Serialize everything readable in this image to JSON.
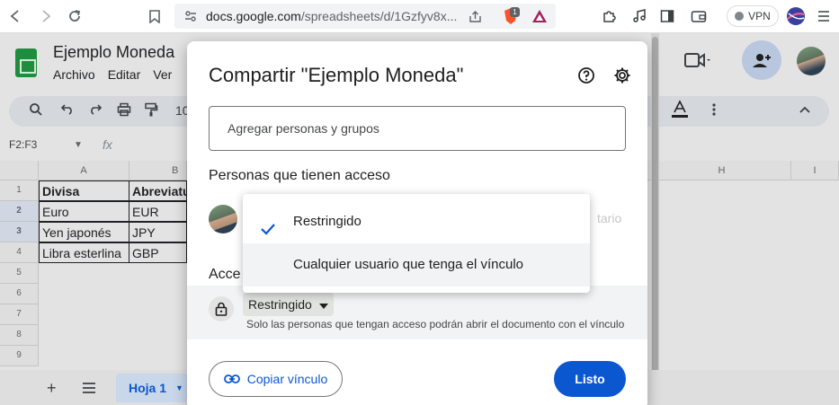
{
  "browser": {
    "url_host": "docs.google.com",
    "url_path": "/spreadsheets/d/1Gzfyv8x...",
    "vpn_label": "VPN",
    "brave_badge": "1"
  },
  "sheets": {
    "doc_title": "Ejemplo Moneda",
    "menu": [
      "Archivo",
      "Editar",
      "Ver"
    ],
    "zoom_partial": "10",
    "name_box": "F2:F3",
    "fx_label": "fx",
    "columns": [
      "A",
      "B",
      "H",
      "I"
    ],
    "rows": [
      "1",
      "2",
      "3",
      "4",
      "5",
      "6",
      "7",
      "8",
      "9"
    ],
    "headers": [
      "Divisa",
      "Abreviatu"
    ],
    "data": [
      [
        "Euro",
        "EUR"
      ],
      [
        "Yen japonés",
        "JPY"
      ],
      [
        "Libra esterlina",
        "GBP"
      ]
    ],
    "sheet_tab": "Hoja 1"
  },
  "dialog": {
    "title": "Compartir \"Ejemplo Moneda\"",
    "add_placeholder": "Agregar personas y grupos",
    "people_title": "Personas que tienen acceso",
    "owner_role_partial": "tario",
    "general_title_partial": "Acce",
    "access_value": "Restringido",
    "access_description": "Solo las personas que tengan acceso podrán abrir el documento con el vínculo",
    "copy_link": "Copiar vínculo",
    "done": "Listo"
  },
  "dropdown": {
    "options": [
      "Restringido",
      "Cualquier usuario que tenga el vínculo"
    ],
    "selected": "Restringido"
  },
  "colors": {
    "accent": "#0b57d0",
    "sheets_green": "#1e8e3e"
  }
}
